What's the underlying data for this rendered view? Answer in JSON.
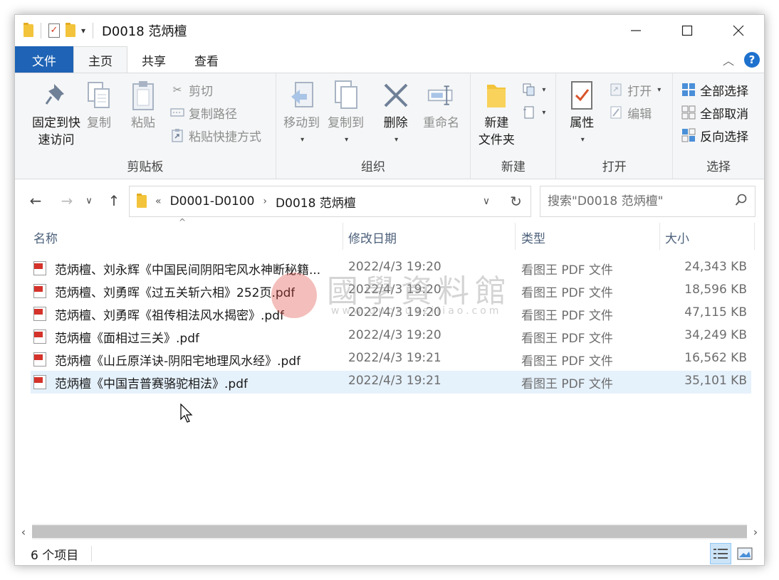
{
  "window": {
    "title": "D0018 范炳檀"
  },
  "tabs": {
    "file": "文件",
    "home": "主页",
    "share": "共享",
    "view": "查看"
  },
  "ribbon": {
    "clipboard": {
      "label": "剪贴板",
      "pin": "固定到快\n速访问",
      "pin_line1": "固定到快",
      "pin_line2": "速访问",
      "copy": "复制",
      "paste": "粘贴",
      "cut": "剪切",
      "copy_path": "复制路径",
      "paste_shortcut": "粘贴快捷方式"
    },
    "organize": {
      "label": "组织",
      "move_to": "移动到",
      "copy_to": "复制到",
      "delete": "删除",
      "rename": "重命名"
    },
    "new": {
      "label": "新建",
      "new_folder_line1": "新建",
      "new_folder_line2": "文件夹"
    },
    "open": {
      "label": "打开",
      "properties": "属性",
      "open": "打开",
      "edit": "编辑"
    },
    "select": {
      "label": "选择",
      "select_all": "全部选择",
      "select_none": "全部取消",
      "invert": "反向选择"
    }
  },
  "address": {
    "overflow": "«",
    "crumbs": [
      "D0001-D0100",
      "D0018 范炳檀"
    ],
    "search_placeholder": "搜索\"D0018 范炳檀\""
  },
  "columns": {
    "name": "名称",
    "date": "修改日期",
    "type": "类型",
    "size": "大小"
  },
  "files": [
    {
      "name": "范炳檀、刘永辉《中国民间阴阳宅风水神断秘籍...",
      "date": "2022/4/3 19:20",
      "type": "看图王 PDF 文件",
      "size": "24,343 KB"
    },
    {
      "name": "范炳檀、刘勇晖《过五关斩六相》252页.pdf",
      "date": "2022/4/3 19:20",
      "type": "看图王 PDF 文件",
      "size": "18,596 KB"
    },
    {
      "name": "范炳檀、刘勇晖《祖传相法风水揭密》.pdf",
      "date": "2022/4/3 19:20",
      "type": "看图王 PDF 文件",
      "size": "47,115 KB"
    },
    {
      "name": "范炳檀《面相过三关》.pdf",
      "date": "2022/4/3 19:20",
      "type": "看图王 PDF 文件",
      "size": "34,249 KB"
    },
    {
      "name": "范炳檀《山丘原洋诀-阴阳宅地理风水经》.pdf",
      "date": "2022/4/3 19:21",
      "type": "看图王 PDF 文件",
      "size": "16,562 KB"
    },
    {
      "name": "范炳檀《中国吉普赛骆驼相法》.pdf",
      "date": "2022/4/3 19:21",
      "type": "看图王 PDF 文件",
      "size": "35,101 KB"
    }
  ],
  "watermark": {
    "text": "國學資料館",
    "url": "www.guoxueziliao.com"
  },
  "status": {
    "count": "6 个项目"
  },
  "colors": {
    "file_tab": "#1e63b5",
    "selected_row": "#e5f1fb",
    "accent": "#1e71cd"
  }
}
